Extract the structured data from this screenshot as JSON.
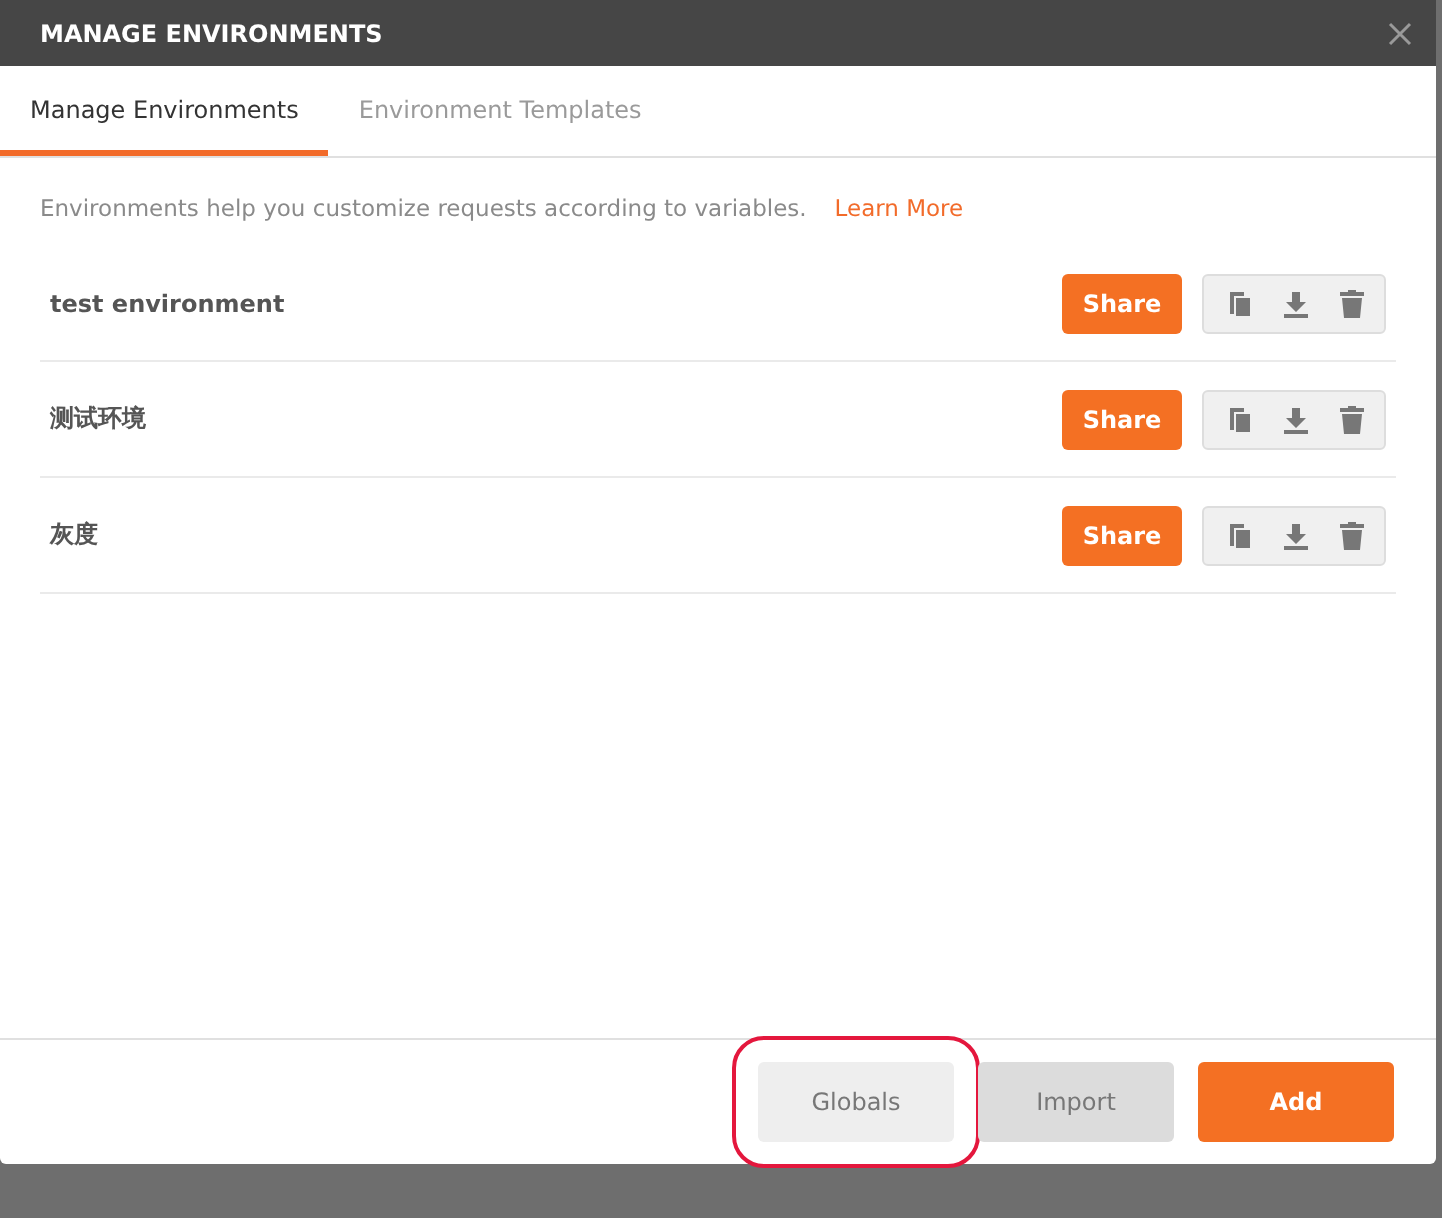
{
  "window": {
    "title": "MANAGE ENVIRONMENTS"
  },
  "tabs": [
    {
      "label": "Manage Environments",
      "selected": true
    },
    {
      "label": "Environment Templates",
      "selected": false
    }
  ],
  "description": {
    "text": "Environments help you customize requests according to variables.",
    "link": "Learn More"
  },
  "environments": [
    {
      "name": "test environment",
      "share": "Share"
    },
    {
      "name": "测试环境",
      "share": "Share"
    },
    {
      "name": "灰度",
      "share": "Share"
    }
  ],
  "footer_buttons": [
    {
      "label": "Globals",
      "kind": "secondary",
      "highlighted": true
    },
    {
      "label": "Import",
      "kind": "muted",
      "highlighted": false
    },
    {
      "label": "Add",
      "kind": "primary",
      "highlighted": false
    }
  ]
}
